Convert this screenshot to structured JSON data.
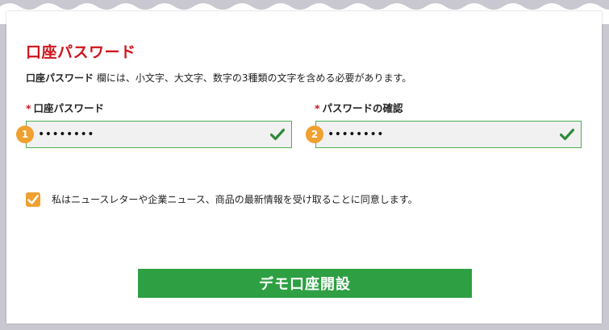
{
  "form": {
    "title": "口座パスワード",
    "note_bold": "口座パスワード",
    "note_rest": " 欄には、小文字、大文字、数字の3種類の文字を含める必要があります。",
    "required_mark": "*",
    "password": {
      "label": "口座パスワード",
      "value": "••••••••",
      "badge": "1",
      "valid_icon": "check-icon"
    },
    "confirm": {
      "label": "パスワードの確認",
      "value": "••••••••",
      "badge": "2",
      "valid_icon": "check-icon"
    },
    "consent": {
      "checked": true,
      "text": "私はニュースレターや企業ニュース、商品の最新情報を受け取ることに同意します。"
    },
    "submit_label": "デモ口座開設"
  },
  "colors": {
    "title": "#d0141c",
    "valid_border": "#4caf50",
    "check_green": "#2e8b3a",
    "badge": "#f0a030",
    "button": "#2ea043",
    "background": "#c9c7d0"
  }
}
